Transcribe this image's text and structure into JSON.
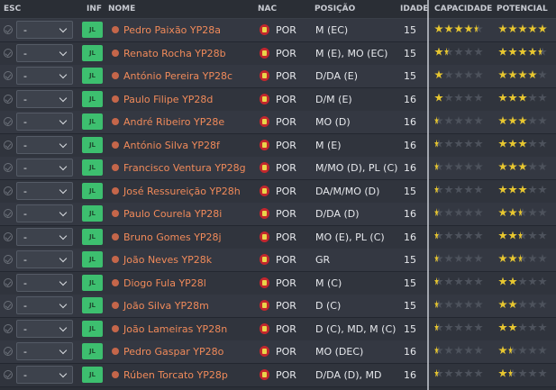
{
  "table": {
    "columns": {
      "esc": "ESC",
      "inf": "INF",
      "nome": "NOME",
      "nac": "NAC",
      "posicao": "POSIÇÃO",
      "idade": "IDADE",
      "capacidade": "CAPACIDADE",
      "potencial": "POTENCIAL"
    },
    "rows": [
      {
        "select": "-",
        "inf": "JL",
        "name": "Pedro Paixão YP28a",
        "nat": "POR",
        "pos": "M (EC)",
        "age": "15",
        "cap": 4.5,
        "pot": 5
      },
      {
        "select": "-",
        "inf": "JL",
        "name": "Renato Rocha YP28b",
        "nat": "POR",
        "pos": "M (E), MO (EC)",
        "age": "15",
        "cap": 1.5,
        "pot": 4.5
      },
      {
        "select": "-",
        "inf": "JL",
        "name": "António Pereira YP28c",
        "nat": "POR",
        "pos": "D/DA (E)",
        "age": "15",
        "cap": 1,
        "pot": 4
      },
      {
        "select": "-",
        "inf": "JL",
        "name": "Paulo Filipe YP28d",
        "nat": "POR",
        "pos": "D/M (E)",
        "age": "16",
        "cap": 1,
        "pot": 3
      },
      {
        "select": "-",
        "inf": "JL",
        "name": "André Ribeiro YP28e",
        "nat": "POR",
        "pos": "MO (D)",
        "age": "16",
        "cap": 0.5,
        "pot": 3
      },
      {
        "select": "-",
        "inf": "JL",
        "name": "António Silva YP28f",
        "nat": "POR",
        "pos": "M (E)",
        "age": "16",
        "cap": 0.5,
        "pot": 3
      },
      {
        "select": "-",
        "inf": "JL",
        "name": "Francisco Ventura YP28g",
        "nat": "POR",
        "pos": "M/MO (D), PL (C)",
        "age": "16",
        "cap": 0.5,
        "pot": 3
      },
      {
        "select": "-",
        "inf": "JL",
        "name": "José Ressureição YP28h",
        "nat": "POR",
        "pos": "DA/M/MO (D)",
        "age": "15",
        "cap": 0.5,
        "pot": 3
      },
      {
        "select": "-",
        "inf": "JL",
        "name": "Paulo Courela YP28i",
        "nat": "POR",
        "pos": "D/DA (D)",
        "age": "16",
        "cap": 0.5,
        "pot": 2.5
      },
      {
        "select": "-",
        "inf": "JL",
        "name": "Bruno Gomes YP28j",
        "nat": "POR",
        "pos": "MO (E), PL (C)",
        "age": "16",
        "cap": 0.5,
        "pot": 2.5
      },
      {
        "select": "-",
        "inf": "JL",
        "name": "João Neves YP28k",
        "nat": "POR",
        "pos": "GR",
        "age": "15",
        "cap": 0.5,
        "pot": 2.5
      },
      {
        "select": "-",
        "inf": "JL",
        "name": "Diogo Fula YP28l",
        "nat": "POR",
        "pos": "M (C)",
        "age": "15",
        "cap": 0.5,
        "pot": 2
      },
      {
        "select": "-",
        "inf": "JL",
        "name": "João Silva YP28m",
        "nat": "POR",
        "pos": "D (C)",
        "age": "15",
        "cap": 0.5,
        "pot": 2
      },
      {
        "select": "-",
        "inf": "JL",
        "name": "João Lameiras YP28n",
        "nat": "POR",
        "pos": "D (C), MD, M (C)",
        "age": "15",
        "cap": 0.5,
        "pot": 2
      },
      {
        "select": "-",
        "inf": "JL",
        "name": "Pedro Gaspar YP28o",
        "nat": "POR",
        "pos": "MO (DEC)",
        "age": "16",
        "cap": 0.5,
        "pot": 1.5
      },
      {
        "select": "-",
        "inf": "JL",
        "name": "Rúben Torcato YP28p",
        "nat": "POR",
        "pos": "D/DA (D), MD",
        "age": "16",
        "cap": 0.5,
        "pot": 1.5
      }
    ]
  }
}
